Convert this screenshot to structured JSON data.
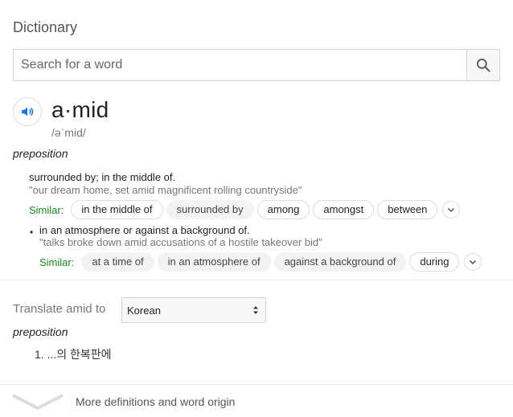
{
  "header": {
    "title": "Dictionary"
  },
  "search": {
    "placeholder": "Search for a word",
    "value": "",
    "button_icon": "search-icon"
  },
  "entry": {
    "headword": "a·mid",
    "phonetic": "/əˈmid/",
    "part_of_speech": "preposition",
    "speaker_icon": "speaker-icon",
    "senses": [
      {
        "definition": "surrounded by; in the middle of.",
        "example": "\"our dream home, set amid magnificent rolling countryside\"",
        "similar_label": "Similar:",
        "similar": [
          "in the middle of",
          "surrounded by",
          "among",
          "amongst",
          "between"
        ]
      },
      {
        "bullet": "•",
        "definition": "in an atmosphere or against a background of.",
        "example": "\"talks broke down amid accusations of a hostile takeover bid\"",
        "similar_label": "Similar:",
        "similar": [
          "at a time of",
          "in an atmosphere of",
          "against a background of",
          "during"
        ]
      }
    ]
  },
  "translate": {
    "label": "Translate amid to",
    "language": "Korean",
    "part_of_speech": "preposition",
    "results": [
      "1. ...의 한복판에"
    ]
  },
  "footer": {
    "more_label": "More definitions and word origin"
  },
  "colors": {
    "similar_label": "#1a8a1a",
    "speaker_blue": "#1a73e8"
  }
}
